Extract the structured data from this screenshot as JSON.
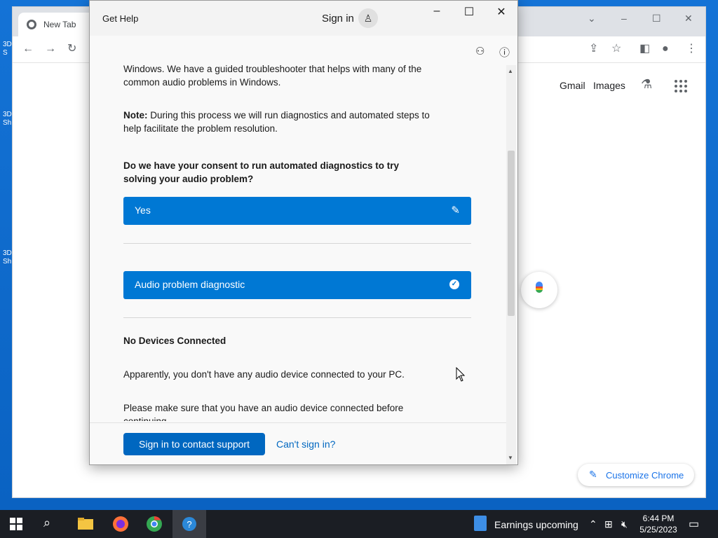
{
  "desktop": {
    "icons": [
      {
        "label": "3D S"
      },
      {
        "label": "3D Sh"
      },
      {
        "label": "3D Sh"
      }
    ]
  },
  "chrome": {
    "tab_title": "New Tab",
    "links": {
      "gmail": "Gmail",
      "images": "Images"
    },
    "customize_label": "Customize Chrome"
  },
  "get_help": {
    "app_title": "Get Help",
    "sign_in_label": "Sign in",
    "body": {
      "intro_text": "Windows. We have a guided troubleshooter that helps with many of the common audio problems in Windows.",
      "note_label": "Note:",
      "note_text": "During this process we will run diagnostics and automated steps to help facilitate the problem resolution.",
      "question": "Do we have your consent to run automated diagnostics to try solving your audio problem?",
      "answer_label": "Yes",
      "diagnostic_label": "Audio problem diagnostic",
      "result_heading": "No Devices Connected",
      "result_text_1": "Apparently, you don't have any audio device connected to your PC.",
      "result_text_2": "Please make sure that you have an audio device connected before continuing."
    },
    "footer": {
      "primary_button": "Sign in to contact support",
      "secondary_link": "Can't sign in?"
    }
  },
  "taskbar": {
    "weather_text": "Earnings upcoming",
    "time": "6:44 PM",
    "date": "5/25/2023"
  }
}
